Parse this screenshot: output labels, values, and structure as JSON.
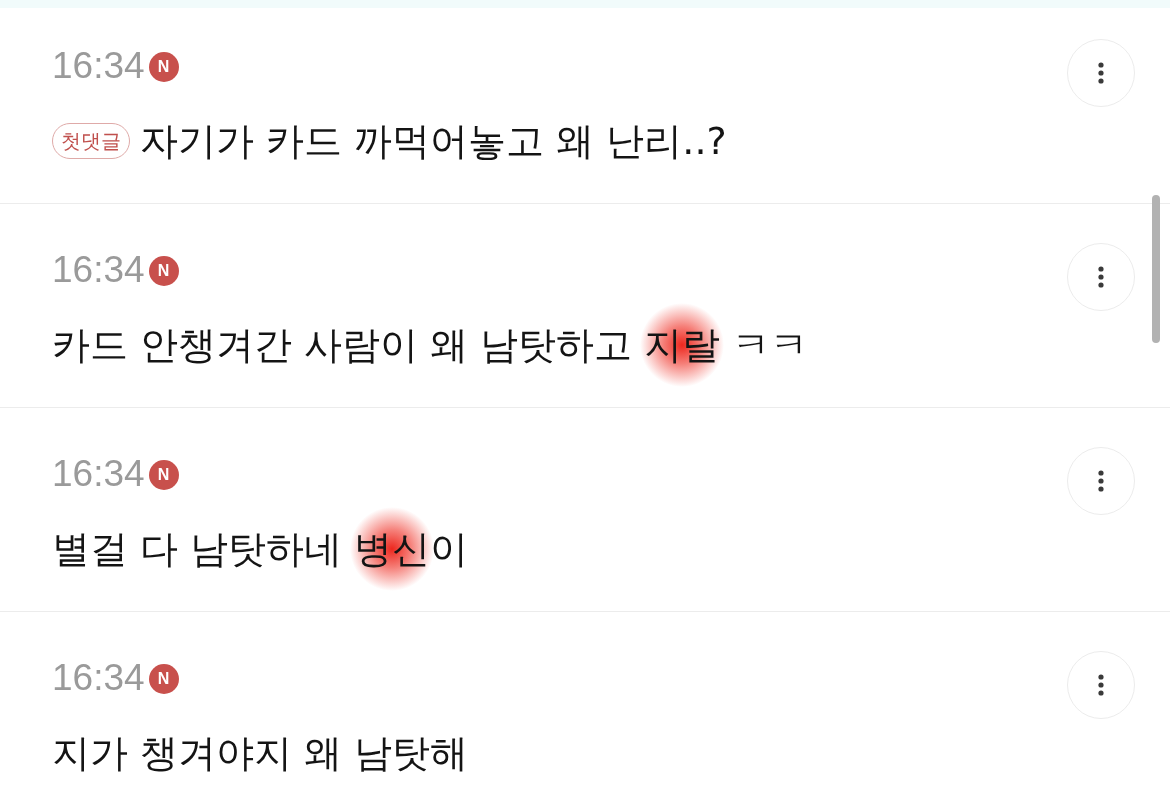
{
  "comments": [
    {
      "time": "16:34",
      "new_badge": "N",
      "tag": "첫댓글",
      "segments": [
        {
          "text": "자기가 카드 까먹어놓고 왜 난리..?",
          "marked": false
        }
      ]
    },
    {
      "time": "16:34",
      "new_badge": "N",
      "segments": [
        {
          "text": "카드 안챙겨간 사람이 왜 남탓하고 ",
          "marked": false
        },
        {
          "text": "지랄",
          "marked": true
        },
        {
          "text": " ㅋㅋ",
          "marked": false
        }
      ]
    },
    {
      "time": "16:34",
      "new_badge": "N",
      "segments": [
        {
          "text": "별걸 다 남탓하네 ",
          "marked": false
        },
        {
          "text": "병신",
          "marked": true
        },
        {
          "text": "이",
          "marked": false
        }
      ]
    },
    {
      "time": "16:34",
      "new_badge": "N",
      "segments": [
        {
          "text": "지가 챙겨야지 왜 남탓해",
          "marked": false
        }
      ]
    }
  ]
}
